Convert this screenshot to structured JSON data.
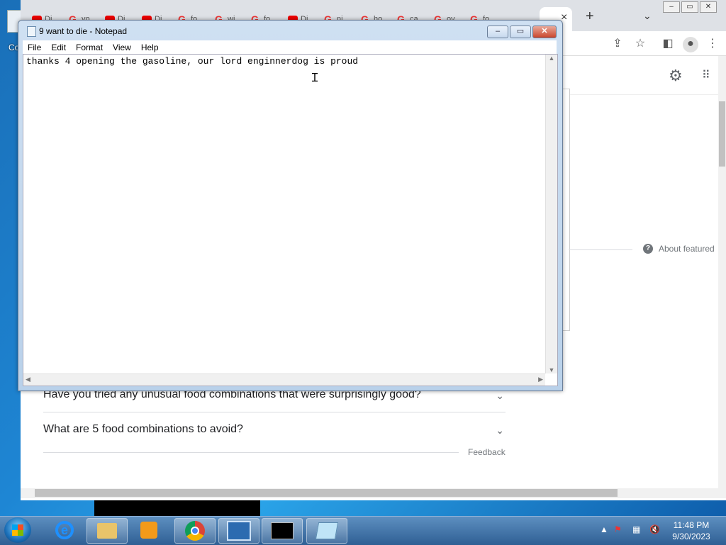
{
  "desktop": {
    "partial_icon_label": "Co"
  },
  "chrome": {
    "tab_fragments": [
      "Di",
      "yo",
      "Di",
      "Di",
      "fo",
      "wi",
      "fo",
      "Di",
      "ni",
      "ho",
      "ca",
      "ov",
      "fo"
    ],
    "new_tab": "+",
    "tab_close": "×",
    "people_also_ask": [
      "Have you tried any unusual food combinations that were surprisingly good?",
      "What are 5 food combinations to avoid?"
    ],
    "feedback": "Feedback",
    "about_featured": "About featured"
  },
  "notepad": {
    "title": "9 want to die - Notepad",
    "menu": [
      "File",
      "Edit",
      "Format",
      "View",
      "Help"
    ],
    "content": "thanks 4 opening the gasoline, our lord enginnerdog is proud"
  },
  "taskbar": {
    "time": "11:48 PM",
    "date": "9/30/2023"
  }
}
